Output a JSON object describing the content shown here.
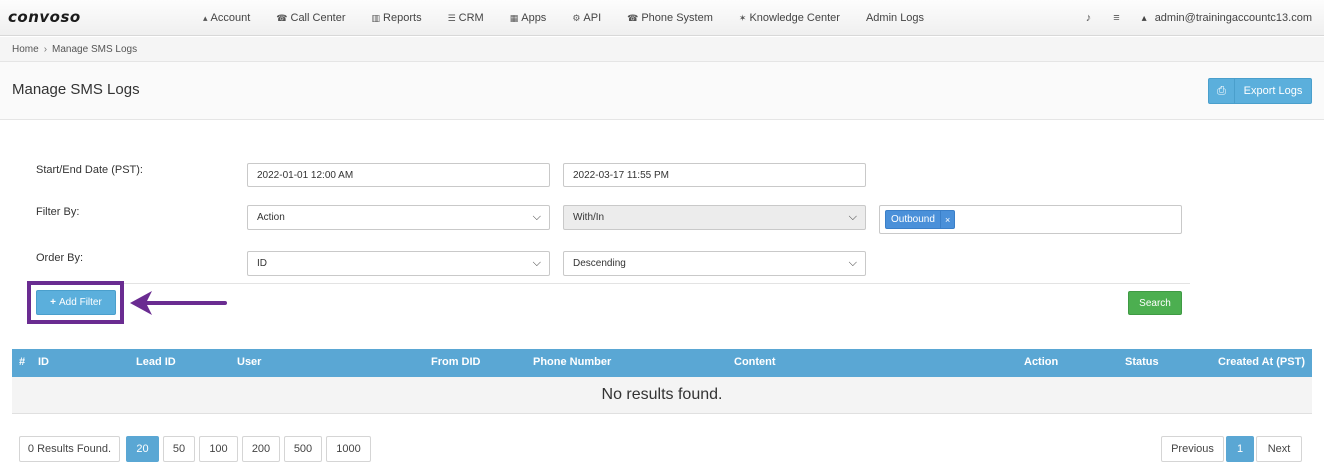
{
  "brand": {
    "logo_text": "convoso"
  },
  "nav": {
    "items": [
      {
        "icon": "user-icon",
        "glyph": "▴",
        "label": "Account"
      },
      {
        "icon": "phone-icon",
        "glyph": "☎",
        "label": "Call Center"
      },
      {
        "icon": "bar-chart-icon",
        "glyph": "▥",
        "label": "Reports"
      },
      {
        "icon": "list-icon",
        "glyph": "☰",
        "label": "CRM"
      },
      {
        "icon": "grid-icon",
        "glyph": "▦",
        "label": "Apps"
      },
      {
        "icon": "gear-icon",
        "glyph": "⚙",
        "label": "API"
      },
      {
        "icon": "phone-icon",
        "glyph": "☎",
        "label": "Phone System"
      },
      {
        "icon": "lightbulb-icon",
        "glyph": "✶",
        "label": "Knowledge Center"
      },
      {
        "icon": "",
        "glyph": "",
        "label": "Admin Logs"
      }
    ],
    "bell_glyph": "♪",
    "db_glyph": "≡",
    "user_glyph": "▴",
    "user_email": "admin@trainingaccountc13.com"
  },
  "breadcrumb": {
    "home": "Home",
    "separator": "›",
    "current": "Manage SMS Logs"
  },
  "header": {
    "title": "Manage SMS Logs",
    "export_label": "Export Logs",
    "export_glyph": "⎙"
  },
  "form": {
    "date_label": "Start/End Date (PST):",
    "start_date": "2022-01-01 12:00 AM",
    "end_date": "2022-03-17 11:55 PM",
    "filter_label": "Filter By:",
    "filter_field": "Action",
    "filter_operator": "With/In",
    "filter_tag": "Outbound",
    "filter_tag_remove": "×",
    "order_label": "Order By:",
    "order_field": "ID",
    "order_direction": "Descending",
    "chevron": "⌵",
    "add_filter_plus": "+",
    "add_filter_label": "Add Filter",
    "search_label": "Search"
  },
  "table": {
    "columns": [
      "#",
      "ID",
      "Lead ID",
      "User",
      "From DID",
      "Phone Number",
      "Content",
      "Action",
      "Status",
      "Created At (PST)"
    ],
    "empty_message": "No results found."
  },
  "pagination": {
    "results_text": "0 Results Found.",
    "page_sizes": [
      "20",
      "50",
      "100",
      "200",
      "500",
      "1000"
    ],
    "selected_page_size": "20",
    "previous": "Previous",
    "current_page": "1",
    "next": "Next"
  },
  "colors": {
    "primary": "#5aa7d4",
    "success": "#4caf50",
    "highlight": "#6a2c91",
    "tag": "#4a90d9"
  }
}
